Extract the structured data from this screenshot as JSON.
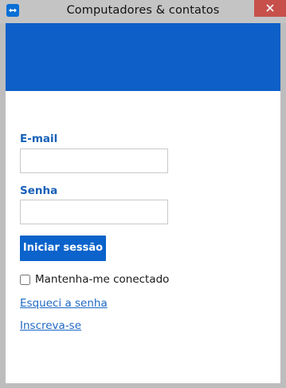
{
  "window": {
    "title": "Computadores & contatos"
  },
  "form": {
    "email_label": "E-mail",
    "email_value": "",
    "password_label": "Senha",
    "password_value": "",
    "login_button": "Iniciar sessão",
    "remember_label": "Mantenha-me conectado",
    "remember_checked": false,
    "forgot_link": "Esqueci a senha",
    "signup_link": "Inscreva-se"
  },
  "colors": {
    "banner": "#0e5fc7",
    "accent": "#0b63cb",
    "label": "#1760b8",
    "link": "#1f68c4",
    "close_button": "#c7504b"
  },
  "icons": {
    "app": "teamviewer-icon",
    "close": "close-icon"
  }
}
